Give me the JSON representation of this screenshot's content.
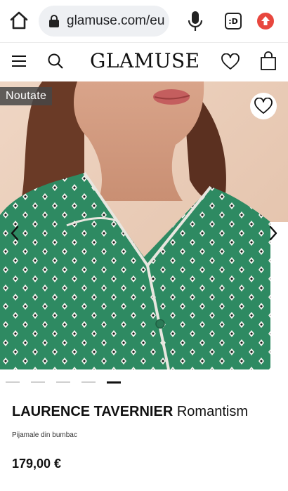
{
  "browser": {
    "url": "glamuse.com/eu",
    "tabs_label": ":D"
  },
  "header": {
    "logo": "GLAMUSE"
  },
  "product": {
    "badge": "Noutate",
    "brand": "LAURENCE TAVERNIER",
    "collection": "Romantism",
    "subtitle": "Pijamale din bumbac",
    "price": "179,00 €",
    "image_count": 5,
    "active_image": 5
  },
  "colors": {
    "accent_red": "#e8473e",
    "blouse_green": "#2e8a62"
  },
  "icons": [
    "home-icon",
    "lock-icon",
    "mic-icon",
    "tabs-icon",
    "update-icon",
    "menu-icon",
    "search-icon",
    "heart-icon",
    "bag-icon",
    "chevron-left-icon",
    "chevron-right-icon"
  ]
}
